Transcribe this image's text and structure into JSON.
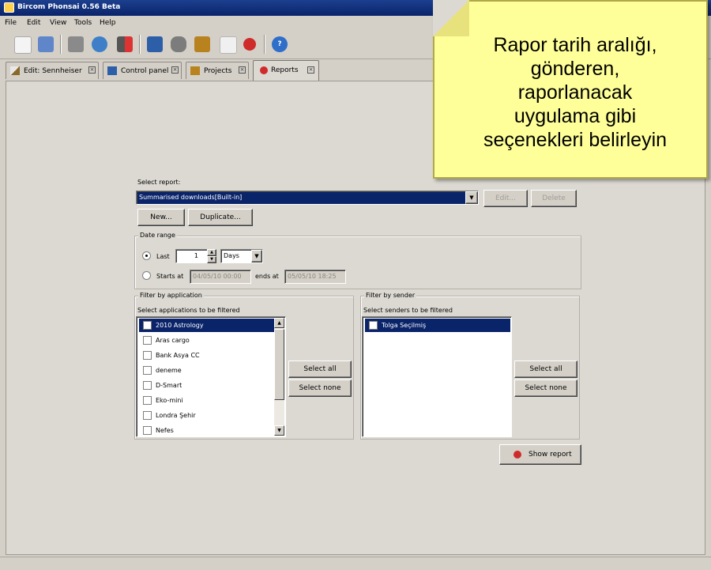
{
  "window": {
    "title": "Bircom Phonsai 0.56 Beta"
  },
  "menu": [
    "File",
    "Edit",
    "View",
    "Tools",
    "Help"
  ],
  "tabs": [
    {
      "label": "Edit: Sennheiser",
      "active": false
    },
    {
      "label": "Control panel",
      "active": false
    },
    {
      "label": "Projects",
      "active": false
    },
    {
      "label": "Reports",
      "active": true
    }
  ],
  "report": {
    "select_label": "Select report:",
    "selected": "Summarised downloads[Built-in]",
    "edit_label": "Edit...",
    "delete_label": "Delete",
    "new_label": "New...",
    "duplicate_label": "Duplicate..."
  },
  "date_range": {
    "label": "Date range",
    "last_label": "Last",
    "last_value": "1",
    "unit": "Days",
    "starts_label": "Starts at",
    "starts_value": "04/05/10 00:00",
    "ends_label": "ends at",
    "ends_value": "05/05/10 18:25"
  },
  "filter_app": {
    "label": "Filter by application",
    "sublabel": "Select applications to be filtered",
    "items": [
      "2010 Astrology",
      "Aras cargo",
      "Bank Asya CC",
      "deneme",
      "D-Smart",
      "Eko-mini",
      "Londra Şehir",
      "Nefes"
    ],
    "select_all": "Select all",
    "select_none": "Select none"
  },
  "filter_sender": {
    "label": "Filter by sender",
    "sublabel": "Select senders to be filtered",
    "items": [
      "Tolga Seçilmiş"
    ],
    "select_all": "Select all",
    "select_none": "Select none"
  },
  "show_report_label": "Show report",
  "callout": {
    "lines": [
      "Rapor tarih aralığı,",
      "gönderen,",
      "raporlanacak",
      "uygulama gibi",
      "seçenekleri belirleyin"
    ]
  },
  "colors": {
    "selection": "#0a246a",
    "callout_bg": "#ffff99",
    "titlebar": "#0a246a"
  },
  "icons": [
    "new-file-icon",
    "open-folder-icon",
    "exit-icon",
    "refresh-icon",
    "import-icon",
    "control-panel-icon",
    "project-icon",
    "mail-icon",
    "stop-icon",
    "help-icon"
  ]
}
